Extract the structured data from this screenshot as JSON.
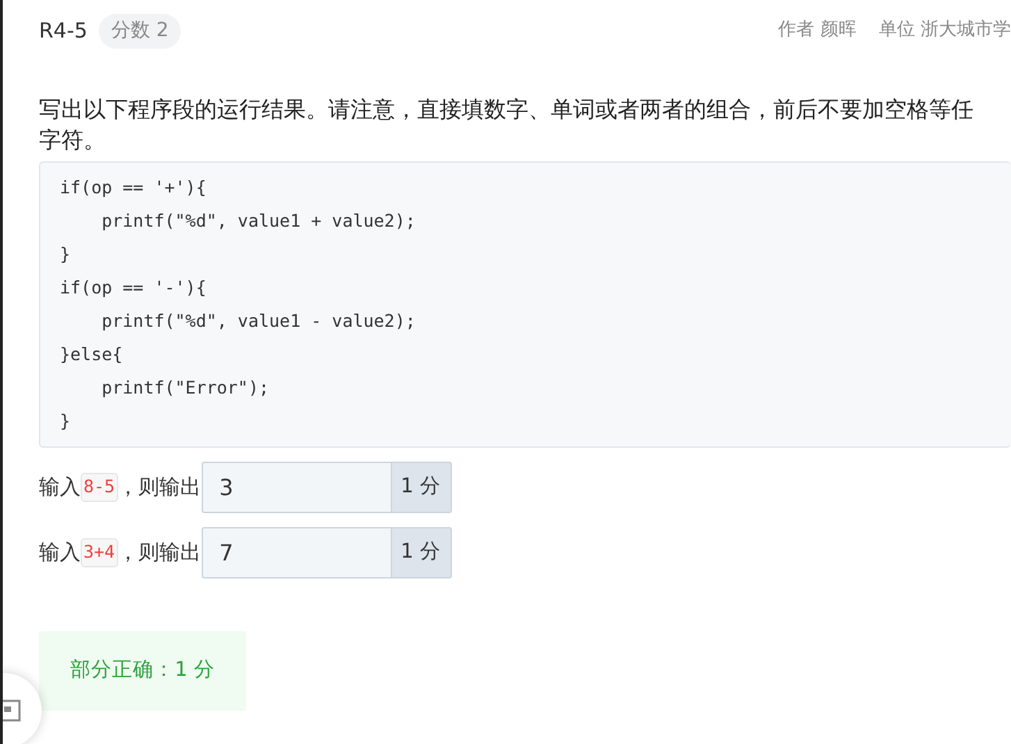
{
  "header": {
    "id": "R4-5",
    "score_badge": "分数 2",
    "author": "作者 颜晖",
    "unit": "单位 浙大城市学"
  },
  "question": {
    "lines": [
      "写出以下程序段的运行结果。请注意，直接填数字、单词或者两者的组合，前后不要加空格等任",
      "字符。"
    ]
  },
  "code": [
    "if(op == '+'){",
    "    printf(\"%d\", value1 + value2);",
    "}",
    "if(op == '-'){",
    "    printf(\"%d\", value1 - value2);",
    "}else{",
    "    printf(\"Error\");",
    "}"
  ],
  "answers": [
    {
      "prefix": "输入",
      "input": "8-5",
      "middle": "，则输出",
      "value": "3",
      "points": "1 分"
    },
    {
      "prefix": "输入",
      "input": "3+4",
      "middle": "，则输出",
      "value": "7",
      "points": "1 分"
    }
  ],
  "result": {
    "text": "部分正确：1 分"
  }
}
